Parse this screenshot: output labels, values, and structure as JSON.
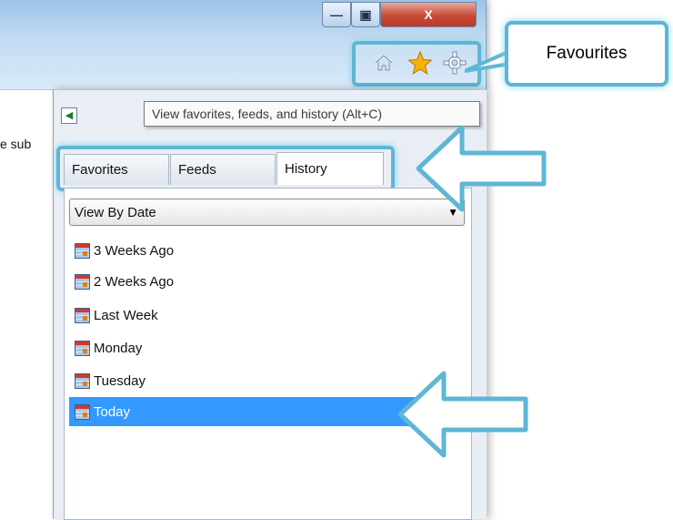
{
  "window": {
    "minimize_label": "—",
    "maximize_label": "▣",
    "close_label": "X"
  },
  "left_pane": {
    "partial_text": "e sub"
  },
  "toolbar": {
    "home_icon": "home-icon",
    "favorites_icon": "star-icon",
    "tools_icon": "gear-icon"
  },
  "tooltip": {
    "text": "View favorites, feeds, and history (Alt+C)"
  },
  "tabs": [
    {
      "label": "Favorites"
    },
    {
      "label": "Feeds"
    },
    {
      "label": "History"
    }
  ],
  "dropdown": {
    "selected": "View By Date"
  },
  "history_items": [
    {
      "label": "3 Weeks Ago"
    },
    {
      "label": "2 Weeks Ago"
    },
    {
      "label": "Last Week"
    },
    {
      "label": "Monday"
    },
    {
      "label": "Tuesday"
    },
    {
      "label": "Today"
    }
  ],
  "callout": {
    "text": "Favourites"
  },
  "colors": {
    "highlight": "#5fb6d4",
    "selection": "#3399ff",
    "star": "#f6b20a"
  }
}
